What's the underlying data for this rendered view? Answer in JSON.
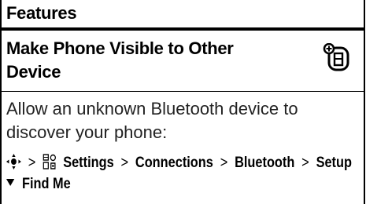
{
  "header": {
    "title": "Features"
  },
  "section": {
    "title": "Make Phone Visible to Other Device",
    "icon": "optional-feature-icon"
  },
  "body": {
    "text": "Allow an unknown Bluetooth device to discover your phone:"
  },
  "path": {
    "nav_icon": "nav-key-icon",
    "settings_icon": "settings-icon",
    "separator": ">",
    "items": [
      "Settings",
      "Connections",
      "Bluetooth",
      "Setup"
    ],
    "last": "Find Me"
  }
}
